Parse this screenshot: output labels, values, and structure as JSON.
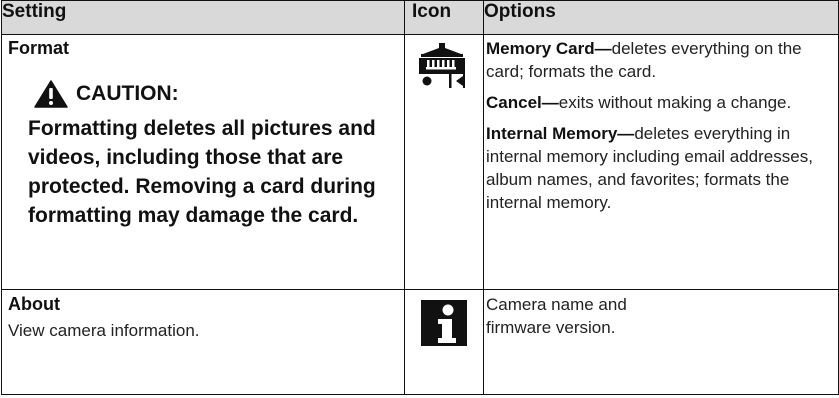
{
  "header": {
    "setting": "Setting",
    "icon": "Icon",
    "options": "Options"
  },
  "format": {
    "title": "Format",
    "caution_label": "CAUTION:",
    "caution_text": "Formatting deletes all pictures and videos, including those that are protected. Removing a card during formatting may damage the card.",
    "icon": "format-card-icon",
    "options": [
      {
        "label": "Memory Card—",
        "text": "deletes everything on the card; formats the card."
      },
      {
        "label": "Cancel—",
        "text": "exits without making a change."
      },
      {
        "label": "Internal Memory—",
        "text": "deletes everything in internal memory including email addresses, album names, and favorites; formats the internal memory."
      }
    ]
  },
  "about": {
    "title": "About",
    "desc": "View camera information.",
    "icon": "info-icon",
    "options": "Camera name and firmware version."
  }
}
